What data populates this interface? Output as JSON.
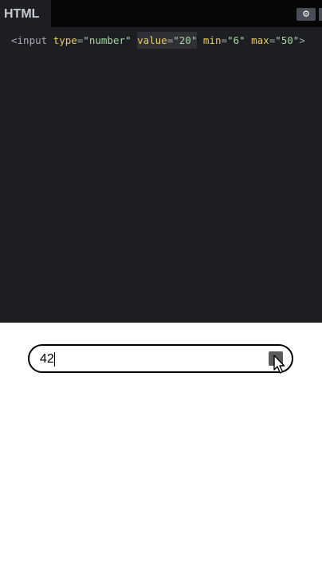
{
  "editor": {
    "tab_label": "HTML",
    "settings_icon": "gear-icon",
    "code": {
      "open": "<input",
      "attr_type": "type",
      "val_type": "\"number\"",
      "attr_value": "value",
      "val_value": "\"20\"",
      "attr_min": "min",
      "val_min": "\"6\"",
      "attr_max": "max",
      "val_max": "\"50\"",
      "close": ">",
      "eq": "="
    }
  },
  "preview": {
    "input": {
      "value": "42"
    },
    "cursor_icon": "arrow-pointer-icon"
  }
}
